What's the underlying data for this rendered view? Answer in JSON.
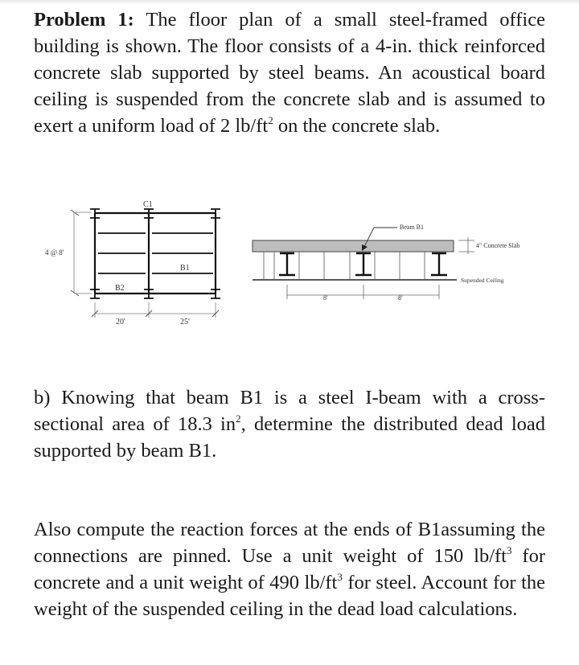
{
  "problem": {
    "label": "Problem 1:",
    "intro": "The floor plan of a small steel-framed office building is shown. The floor consists of a 4-in. thick reinforced concrete slab supported by steel beams. An acoustical board ceiling is suspended from the concrete slab and is assumed to exert a uniform load of 2 lb/ft",
    "intro_sup": "2",
    "intro_end": " on the concrete slab."
  },
  "part_b": {
    "text_1": "b) Knowing that beam B1 is a steel I-beam with a cross-sectional area of 18.3 in",
    "sup": "2",
    "text_2": ", determine the distributed dead load supported by beam B1."
  },
  "part_c": {
    "text_1": "Also compute the reaction forces at the ends of B1assuming the connections are pinned. Use a unit weight of 150 lb/ft",
    "sup_1": "3",
    "text_2": " for concrete and a unit weight of 490 lb/ft",
    "sup_2": "3",
    "text_3": " for steel. Account for the weight of the suspended ceiling in the dead load calculations."
  },
  "floor_plan": {
    "column_label": "C1",
    "beam_b1_label": "B1",
    "beam_b2_label": "B2",
    "spacing_label": "4 @ 8'",
    "span_left": "20'",
    "span_right": "25'"
  },
  "section": {
    "beam_label": "Beam B1",
    "slab_label": "4\" Concrete Slab",
    "ceiling_label": "Supended Ceiling",
    "spacing_left": "8'",
    "spacing_right": "8'"
  }
}
